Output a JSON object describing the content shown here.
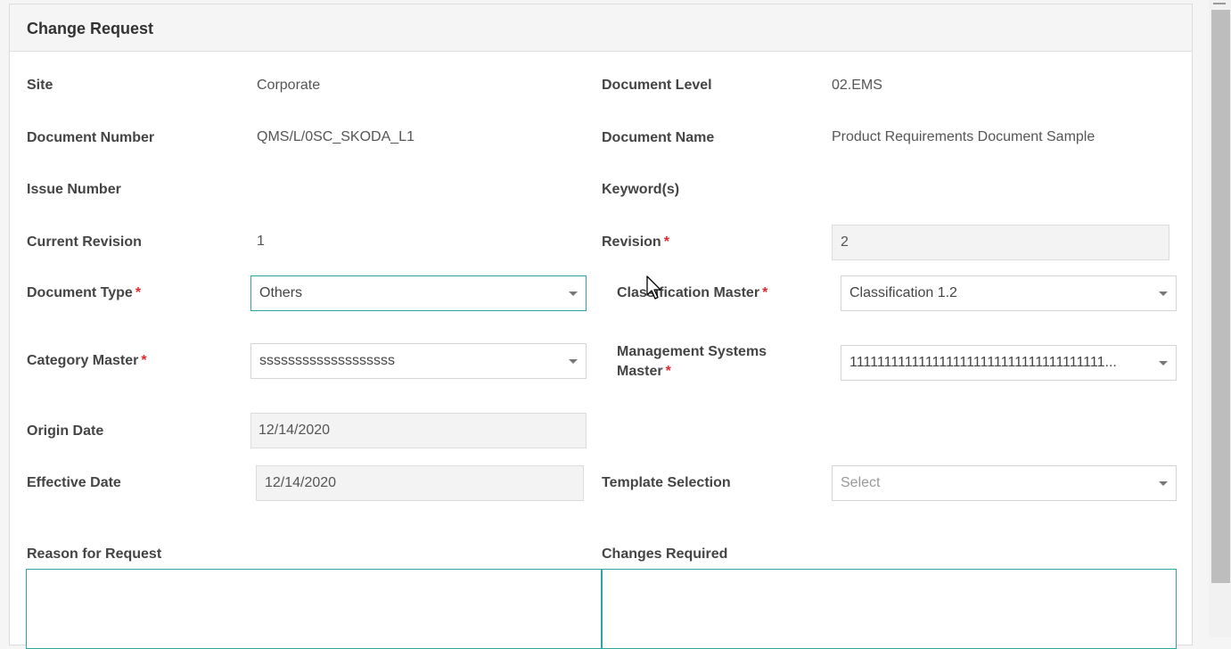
{
  "panel": {
    "title": "Change Request"
  },
  "fields": {
    "site": {
      "label": "Site",
      "value": "Corporate"
    },
    "document_level": {
      "label": "Document Level",
      "value": "02.EMS"
    },
    "document_number": {
      "label": "Document Number",
      "value": "QMS/L/0SC_SKODA_L1"
    },
    "document_name": {
      "label": "Document Name",
      "value": "Product Requirements Document Sample"
    },
    "issue_number": {
      "label": "Issue Number",
      "value": ""
    },
    "keywords": {
      "label": "Keyword(s)",
      "value": ""
    },
    "current_revision": {
      "label": "Current Revision",
      "value": "1"
    },
    "revision": {
      "label": "Revision",
      "required_mark": "*",
      "value": "2"
    },
    "document_type": {
      "label": "Document Type",
      "required_mark": "*",
      "value": "Others"
    },
    "classification_master": {
      "label": "Classification Master",
      "required_mark": "*",
      "value": "Classification 1.2"
    },
    "category_master": {
      "label": "Category Master",
      "required_mark": "*",
      "value": "sssssssssssssssssss"
    },
    "management_systems_master": {
      "label": "Management Systems Master",
      "required_mark": "*",
      "value": "1111111111111111111111111111111111111..."
    },
    "origin_date": {
      "label": "Origin Date",
      "value": "12/14/2020"
    },
    "effective_date": {
      "label": "Effective Date",
      "value": "12/14/2020"
    },
    "template_selection": {
      "label": "Template Selection",
      "placeholder": "Select"
    },
    "reason_for_request": {
      "label": "Reason for Request",
      "value": ""
    },
    "changes_required": {
      "label": "Changes Required",
      "value": ""
    }
  },
  "colors": {
    "accent": "#2ba6a0",
    "required": "#e0282d",
    "readonly_bg": "#f3f3f3"
  },
  "icons": {
    "dropdown": "chevron-down-icon",
    "cursor": "mouse-pointer-icon"
  }
}
